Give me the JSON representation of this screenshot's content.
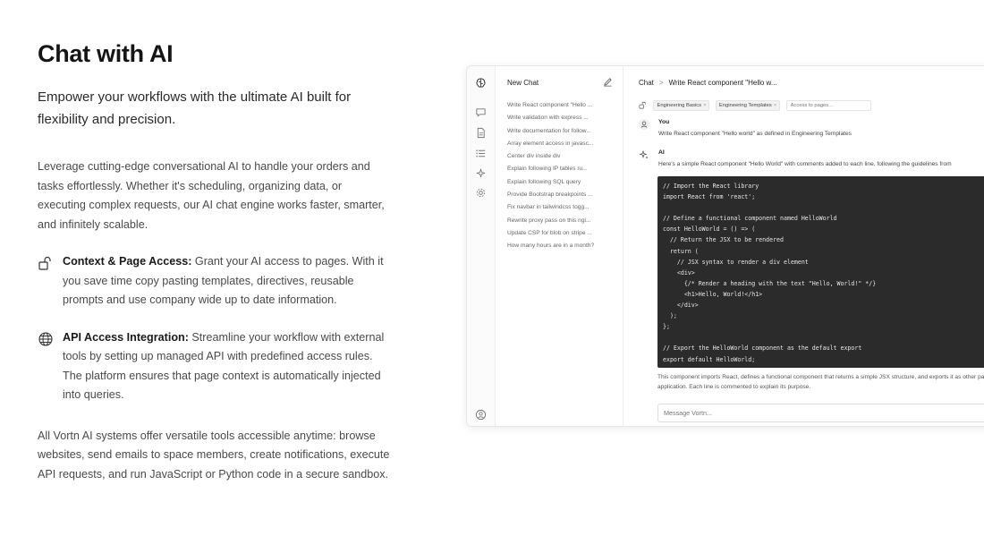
{
  "hero": {
    "title": "Chat with AI",
    "subtitle": "Empower your workflows with the ultimate AI built for flexibility and precision.",
    "intro": "Leverage cutting-edge conversational AI to handle your orders and tasks effortlessly. Whether it's scheduling, organizing data, or executing complex requests, our AI chat engine works faster, smarter, and infinitely scalable.",
    "features": [
      {
        "icon": "lock-open-icon",
        "title": "Context & Page Access:",
        "text": " Grant your AI access to pages. With it you save time copy pasting templates, directives, reusable prompts and use company wide up to date information."
      },
      {
        "icon": "globe-icon",
        "title": "API Access Integration:",
        "text": " Streamline your workflow with external tools by setting up managed API with predefined access rules. The platform ensures that page context is automatically injected into queries."
      }
    ],
    "outro": "All Vortn AI systems offer versatile tools accessible anytime: browse websites, send emails to space members, create notifications, execute API requests, and run JavaScript or Python code in a secure sandbox."
  },
  "app": {
    "rail_icons": [
      "brain-logo-icon",
      "chat-bubble-icon",
      "document-icon",
      "list-icon",
      "sparkles-icon",
      "settings-icon",
      "user-circle-icon"
    ],
    "sidebar": {
      "new_chat_label": "New Chat",
      "chats": [
        "Write React component \"Hello ...",
        "Write validation with express ...",
        "Write documentation for follow...",
        "Array element access in javasc...",
        "Center div inside div",
        "Explain following IP tables ru...",
        "Explain following SQL query",
        "Provide Bootstrap breakpoints ...",
        "Fix navbar in tailwindcss togg...",
        "Rewrite proxy pass on this ngi...",
        "Update CSP for blob on stripe ...",
        "How many hours are in a month?"
      ]
    },
    "header": {
      "crumb_root": "Chat",
      "crumb_sep": ">",
      "crumb_current": "Write React component \"Hello w..."
    },
    "context": {
      "chips": [
        "Engineering Basics",
        "Engineering Templates"
      ],
      "remove_glyph": "×",
      "input_placeholder": "Access to pages..."
    },
    "messages": {
      "user_name": "You",
      "user_text": "Write React component \"Hello world\" as defined in Engineering Templates",
      "ai_name": "AI",
      "ai_intro": "Here's a simple React component \"Hello World\" with comments added to each line, following the guidelines from",
      "code_lines": [
        "// Import the React library",
        "import React from 'react';",
        "",
        "// Define a functional component named HelloWorld",
        "const HelloWorld = () => (",
        "  // Return the JSX to be rendered",
        "  return (",
        "    // JSX syntax to render a div element",
        "    <div>",
        "      {/* Render a heading with the text \"Hello, World!\" */}",
        "      <h1>Hello, World!</h1>",
        "    </div>",
        "  );",
        "};",
        "",
        "// Export the HelloWorld component as the default export",
        "export default HelloWorld;"
      ],
      "ai_outro": "This component imports React, defines a functional component that returns a simple JSX structure, and exports it as other parts of the application. Each line is commented to explain its purpose."
    },
    "composer_placeholder": "Message Vortn..."
  }
}
